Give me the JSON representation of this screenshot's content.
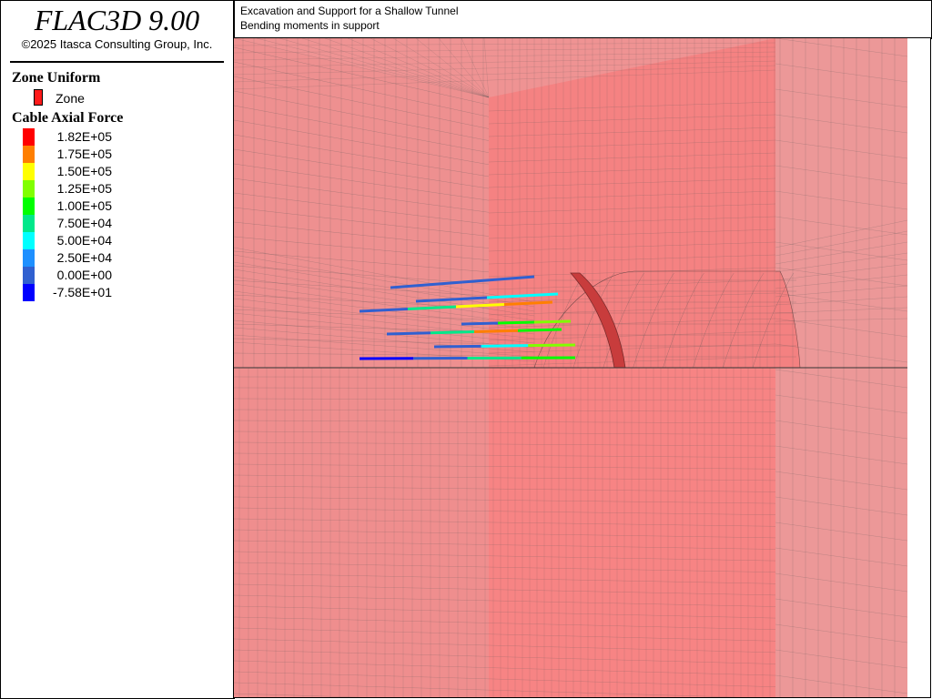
{
  "app": {
    "title": "FLAC3D 9.00",
    "copyright": "©2025 Itasca Consulting Group, Inc."
  },
  "header": {
    "line1": "Excavation and Support for a Shallow Tunnel",
    "line2": "Bending moments in support"
  },
  "legend": {
    "zone_title": "Zone Uniform",
    "zone_label": "Zone",
    "zone_color": "#ff1a1a",
    "cable_title": "Cable Axial Force",
    "ramp": [
      {
        "label": "1.82E+05",
        "color": "#ff0000"
      },
      {
        "label": "1.75E+05",
        "color": "#ff7f00"
      },
      {
        "label": "1.50E+05",
        "color": "#ffff00"
      },
      {
        "label": "1.25E+05",
        "color": "#80ff00"
      },
      {
        "label": "1.00E+05",
        "color": "#00ff00"
      },
      {
        "label": "7.50E+04",
        "color": "#00e88a"
      },
      {
        "label": "5.00E+04",
        "color": "#00ffff"
      },
      {
        "label": "2.50E+04",
        "color": "#1e90ff"
      },
      {
        "label": "0.00E+00",
        "color": "#3060d0"
      },
      {
        "label": "-7.58E+01",
        "color": "#0000ff"
      }
    ]
  },
  "scene": {
    "zone_fill": "#f08080",
    "zone_fill_bright": "#f87878",
    "grid_color": "#555555",
    "lining_color": "#c83c3c"
  }
}
